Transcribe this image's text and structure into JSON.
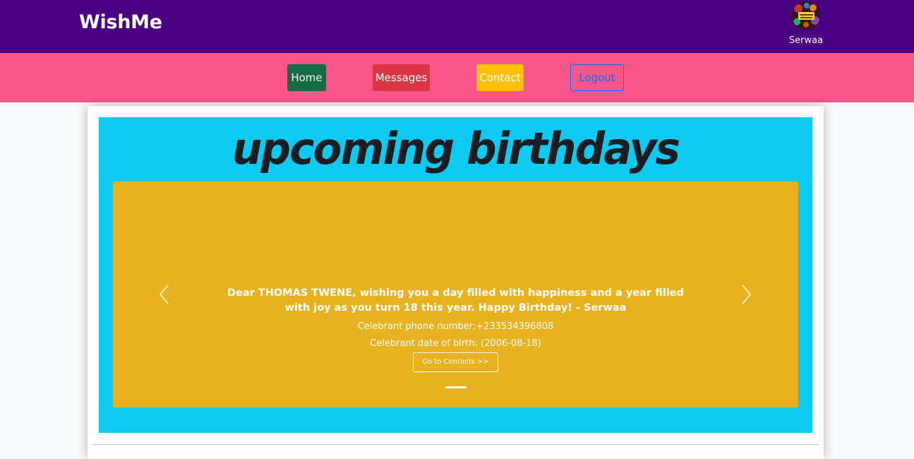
{
  "header": {
    "brand": "WishMe",
    "user_name": "Serwaa"
  },
  "nav": {
    "home": "Home",
    "messages": "Messages",
    "contact": "Contact",
    "logout": "Logout"
  },
  "colors": {
    "topbar": "#4b0082",
    "navbar": "#f8558a",
    "panel": "#0dcaf0",
    "carousel": "#e8b21f"
  },
  "section": {
    "title": "upcoming birthdays"
  },
  "carousel": {
    "slides": [
      {
        "wish": "Dear THOMAS TWENE, wishing you a day filled with happiness and a year filled with joy as you turn 18 this year. Happy Birthday! - Serwaa",
        "phone_line": "Celebrant phone number:+233534396808",
        "dob_line": "Celebrant date of birth: (2006-08-18)",
        "button_label": "Go to Contacts >>"
      }
    ],
    "prev_icon": "chevron-left-icon",
    "next_icon": "chevron-right-icon"
  }
}
